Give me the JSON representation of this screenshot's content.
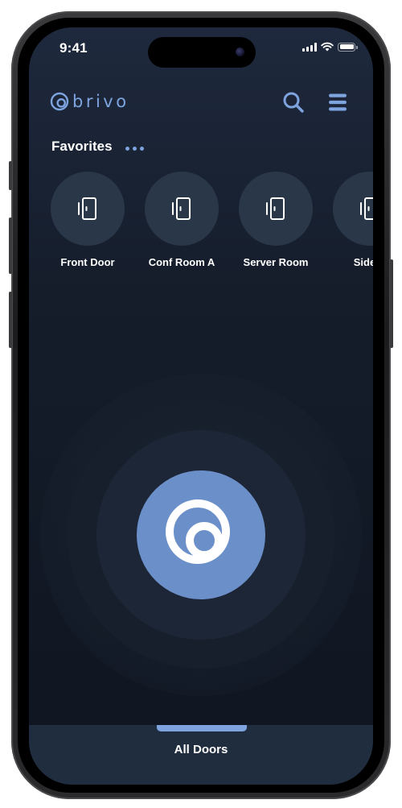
{
  "status_bar": {
    "time": "9:41"
  },
  "header": {
    "logo_text": "brivo",
    "search_icon": "search-icon",
    "menu_icon": "hamburger-menu-icon"
  },
  "favorites": {
    "title": "Favorites",
    "more_icon": "more-dots-icon",
    "items": [
      {
        "label": "Front Door",
        "icon": "door-icon"
      },
      {
        "label": "Conf Room A",
        "icon": "door-icon"
      },
      {
        "label": "Server Room",
        "icon": "door-icon"
      },
      {
        "label": "Side D",
        "icon": "door-icon"
      }
    ]
  },
  "unlock_button": {
    "icon": "brivo-mark-icon"
  },
  "bottom_tab": {
    "label": "All Doors"
  },
  "colors": {
    "accent": "#7ea4df",
    "unlock_button": "#6b8fc9",
    "background_top": "#1e293d",
    "background_bottom": "#0f1520",
    "favorite_circle": "#2a3748",
    "tab_bar": "#1f2d3e"
  }
}
